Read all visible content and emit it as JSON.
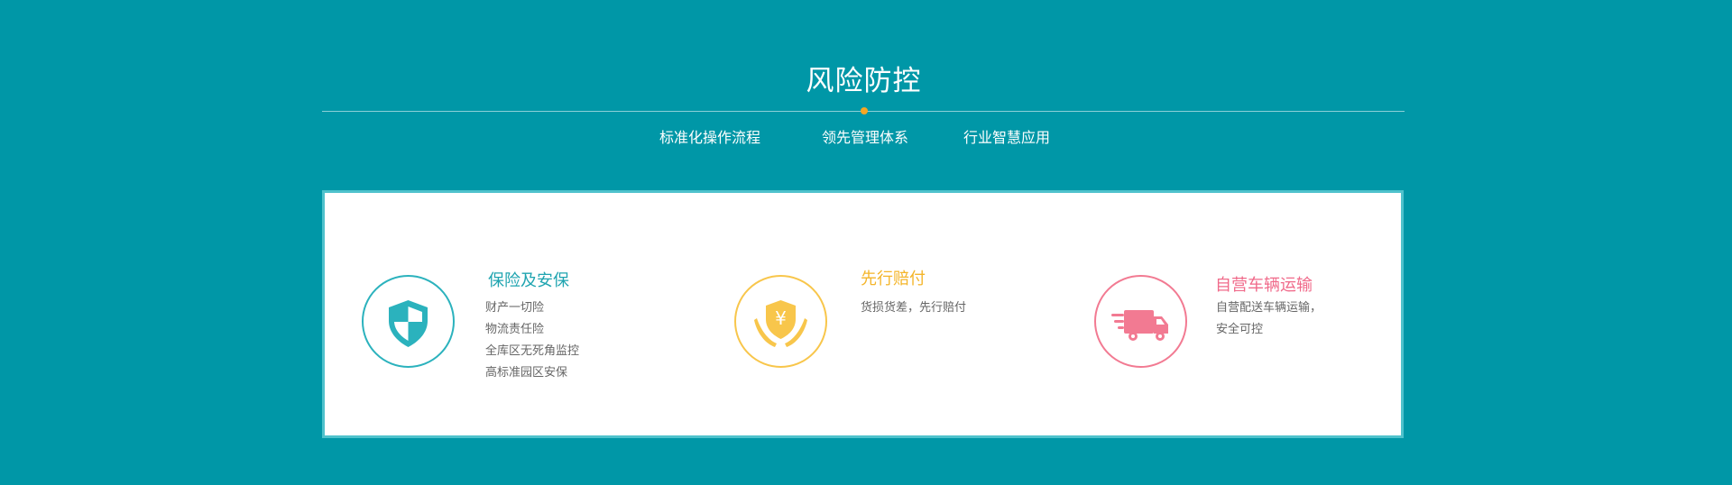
{
  "section": {
    "title": "风险防控"
  },
  "subnav": {
    "items": [
      "标准化操作流程",
      "领先管理体系",
      "行业智慧应用"
    ]
  },
  "features": [
    {
      "title": "保险及安保",
      "lines": [
        "财产一切险",
        "物流责任险",
        "全库区无死角监控",
        "高标准园区安保"
      ],
      "icon": "shield-icon",
      "color": "#2bb2bd"
    },
    {
      "title": "先行赔付",
      "lines": [
        "货损货差，先行赔付"
      ],
      "icon": "hands-yen-icon",
      "color": "#f8c64b"
    },
    {
      "title": "自营车辆运输",
      "lines": [
        "自营配送车辆运输，",
        "安全可控"
      ],
      "icon": "truck-icon",
      "color": "#f27a92"
    }
  ],
  "colors": {
    "background": "#0097a7",
    "panel_border": "#4fc2cc",
    "accent_dot": "#f6a623"
  }
}
